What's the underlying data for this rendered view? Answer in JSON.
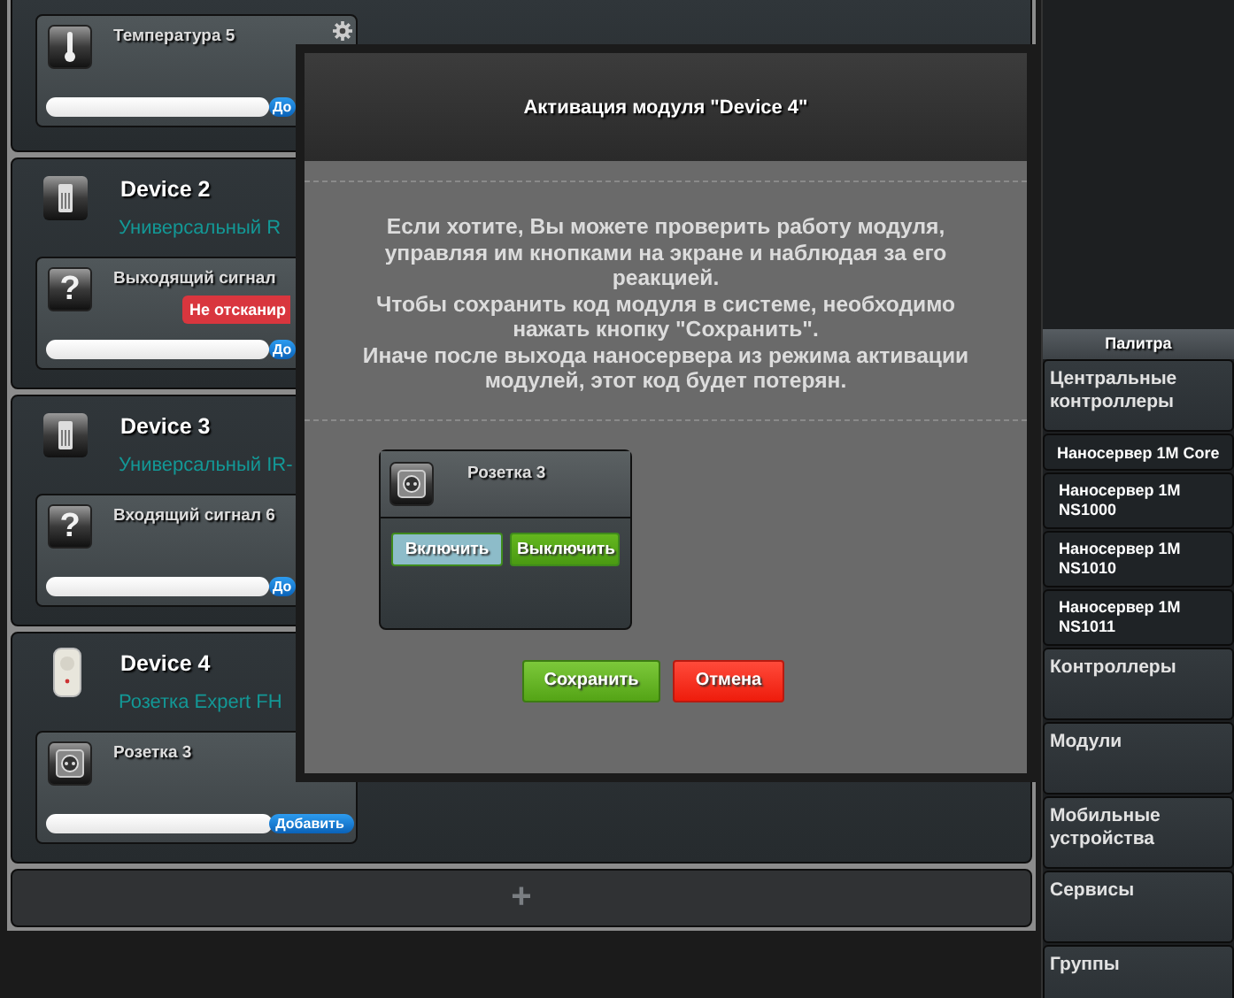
{
  "left_panels": [
    {
      "modules": [
        {
          "name": "Температура 5",
          "kind": "thermometer",
          "settings": true,
          "add_button": "До"
        }
      ]
    },
    {
      "device": {
        "name": "Device 2",
        "type": "Универсальный R",
        "kind": "remote"
      },
      "modules": [
        {
          "name": "Выходящий сигнал",
          "kind": "question",
          "icon_glyph": "?",
          "status": "Не отсканир",
          "add_button": "До"
        }
      ]
    },
    {
      "device": {
        "name": "Device 3",
        "type": "Универсальный IR-",
        "kind": "remote"
      },
      "modules": [
        {
          "name": "Входящий сигнал 6",
          "kind": "question",
          "icon_glyph": "?",
          "add_button": "До"
        }
      ]
    },
    {
      "device": {
        "name": "Device 4",
        "type": "Розетка Expert FH",
        "kind": "plug"
      },
      "modules": [
        {
          "name": "Розетка 3",
          "kind": "socket",
          "add_button": "Добавить"
        }
      ]
    }
  ],
  "add_bar": {
    "label": "+"
  },
  "palette": {
    "title": "Палитра",
    "items": [
      {
        "label": "Центральные контроллеры",
        "kind": "category"
      },
      {
        "label": "Наносервер 1M Core",
        "kind": "device"
      },
      {
        "label": "Наносервер 1M NS1000",
        "kind": "device"
      },
      {
        "label": "Наносервер 1M NS1010",
        "kind": "device"
      },
      {
        "label": "Наносервер 1M NS1011",
        "kind": "device"
      },
      {
        "label": "Контроллеры",
        "kind": "category"
      },
      {
        "label": "Модули",
        "kind": "category"
      },
      {
        "label": "Мобильные устройства",
        "kind": "category"
      },
      {
        "label": "Сервисы",
        "kind": "category"
      },
      {
        "label": "Группы",
        "kind": "category"
      }
    ]
  },
  "modal": {
    "title": "Активация модуля \"Device 4\"",
    "message": [
      "Если хотите, Вы можете проверить работу модуля, управляя им кнопками на экране и наблюдая за его реакцией.",
      "Чтобы сохранить код модуля в системе, необходимо нажать кнопку \"Сохранить\".",
      "Иначе после выхода наносервера из режима активации модулей, этот код будет потерян."
    ],
    "module": {
      "name": "Розетка 3",
      "kind": "socket",
      "buttons": [
        {
          "label": "Включить",
          "selected": true
        },
        {
          "label": "Выключить",
          "selected": false
        }
      ]
    },
    "buttons": [
      {
        "label": "Сохранить",
        "kind": "save"
      },
      {
        "label": "Отмена",
        "kind": "cancel"
      }
    ]
  }
}
